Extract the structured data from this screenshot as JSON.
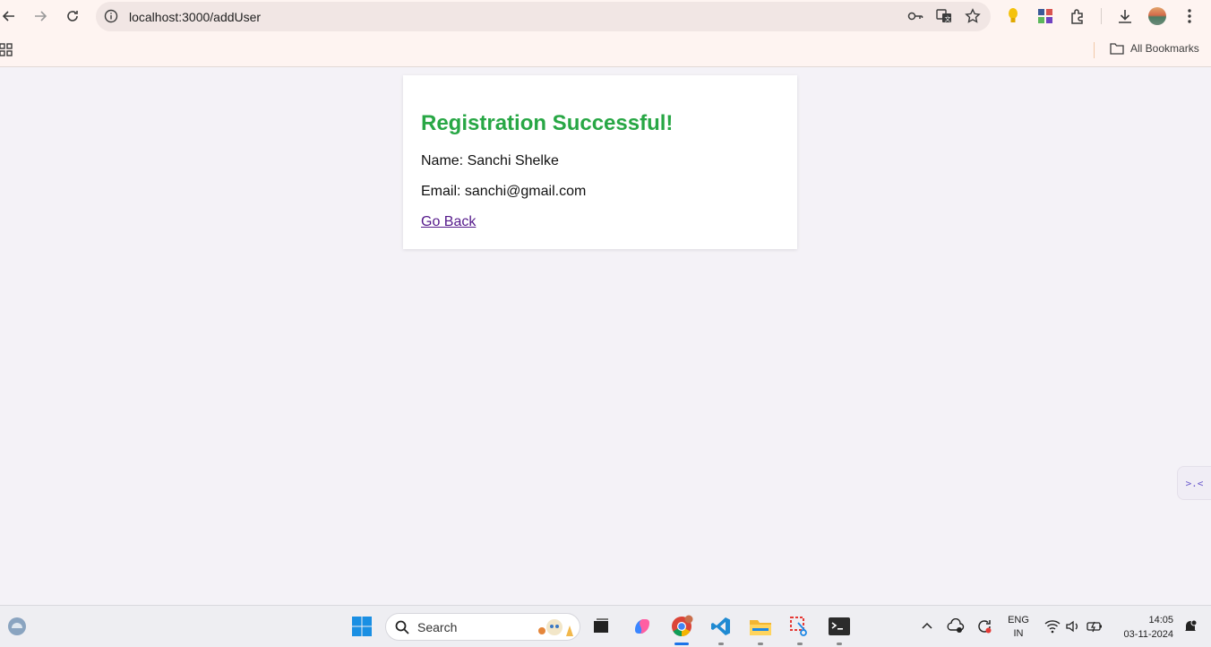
{
  "browser": {
    "url": "localhost:3000/addUser",
    "bookmarks_label": "All Bookmarks"
  },
  "page": {
    "heading": "Registration Successful!",
    "name_line": "Name: Sanchi Shelke",
    "email_line": "Email: sanchi@gmail.com",
    "go_back_label": "Go Back",
    "heading_color": "#28a745",
    "link_color": "#551a8b"
  },
  "side_tab": {
    "glyph": ">.<"
  },
  "taskbar": {
    "search_placeholder": "Search",
    "lang_top": "ENG",
    "lang_bottom": "IN",
    "time": "14:05",
    "date": "03-11-2024"
  }
}
